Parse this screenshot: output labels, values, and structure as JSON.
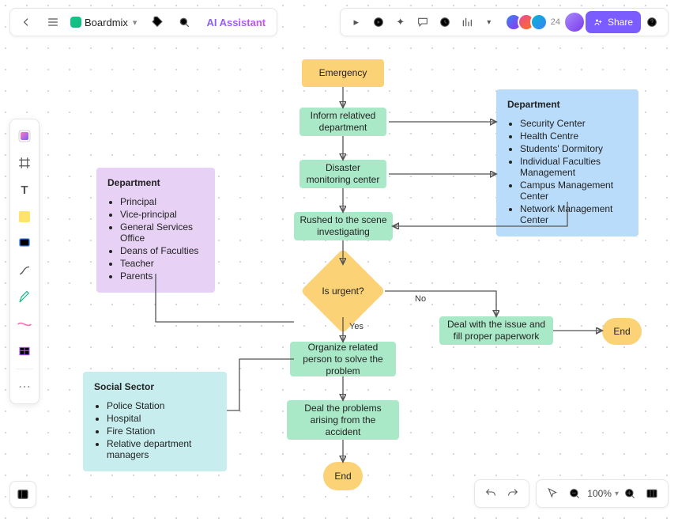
{
  "header": {
    "brand": "Boardmix",
    "ai_label": "AI Assistant",
    "avatar_count": "24",
    "share": "Share"
  },
  "tooltips": {
    "back": "Back",
    "menu": "Menu",
    "tag": "Tag",
    "search": "Search",
    "expand": "Expand",
    "play": "Present",
    "stickers": "Stickers",
    "comment": "Comment",
    "history": "History",
    "chart": "Insert chart",
    "more": "More",
    "help": "Help"
  },
  "left_tools": [
    {
      "name": "assets-icon"
    },
    {
      "name": "frame-icon"
    },
    {
      "name": "text-icon"
    },
    {
      "name": "sticky-note-icon"
    },
    {
      "name": "shape-icon"
    },
    {
      "name": "connector-icon"
    },
    {
      "name": "pen-icon"
    },
    {
      "name": "highlighter-icon"
    },
    {
      "name": "table-icon"
    }
  ],
  "bottom": {
    "zoom": "100%"
  },
  "flow": {
    "n_emergency": "Emergency",
    "n_inform": "Inform relatived department",
    "n_monitor": "Disaster monitoring center",
    "n_rushed": "Rushed to the scene investigating",
    "n_decision": "Is urgent?",
    "lbl_yes": "Yes",
    "lbl_no": "No",
    "n_organize": "Organize related person to solve the problem",
    "n_dealacc": "Deal the problems arising from the accident",
    "n_dealpaper": "Deal with the issue and fill proper paperwork",
    "n_end1": "End",
    "n_end2": "End",
    "dept_blue_title": "Department",
    "dept_blue_items": [
      "Security Center",
      "Health Centre",
      "Students' Dormitory",
      "Individual Faculties Management",
      "Campus Management Center",
      "Network Management Center"
    ],
    "dept_purple_title": "Department",
    "dept_purple_items": [
      "Principal",
      "Vice-principal",
      "General Services Office",
      "Deans of Faculties",
      "Teacher",
      "Parents"
    ],
    "sector_title": "Social Sector",
    "sector_items": [
      "Police Station",
      "Hospital",
      "Fire Station",
      "Relative department managers"
    ]
  }
}
